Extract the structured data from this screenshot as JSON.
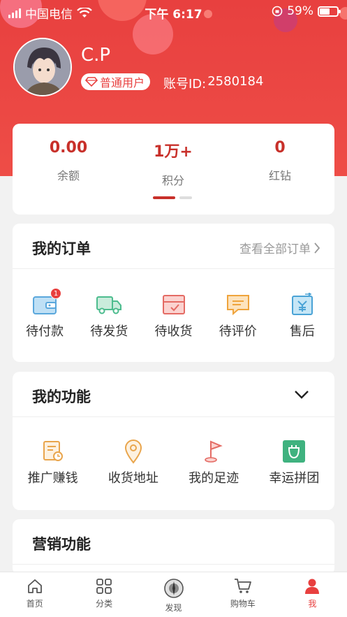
{
  "status_bar": {
    "carrier": "中国电信",
    "time": "下午 6:17",
    "battery_text": "59%",
    "battery_level": 0.59
  },
  "profile": {
    "name": "C.P",
    "level": "普通用户",
    "account_label": "账号ID:",
    "account_id": "2580184"
  },
  "stats": [
    {
      "value": "0.00",
      "label": "余额"
    },
    {
      "value": "1万+",
      "label": "积分"
    },
    {
      "value": "0",
      "label": "红钻"
    }
  ],
  "orders": {
    "title": "我的订单",
    "view_all": "查看全部订单",
    "items": [
      {
        "label": "待付款",
        "icon": "wallet-icon",
        "badge": "1"
      },
      {
        "label": "待发货",
        "icon": "truck-icon"
      },
      {
        "label": "待收货",
        "icon": "package-icon"
      },
      {
        "label": "待评价",
        "icon": "comment-icon"
      },
      {
        "label": "售后",
        "icon": "refund-icon"
      }
    ]
  },
  "functions": {
    "title": "我的功能",
    "items": [
      {
        "label": "推广赚钱",
        "icon": "promote-icon"
      },
      {
        "label": "收货地址",
        "icon": "location-icon"
      },
      {
        "label": "我的足迹",
        "icon": "flag-icon"
      },
      {
        "label": "幸运拼团",
        "icon": "lucky-group-icon"
      }
    ]
  },
  "marketing": {
    "title": "营销功能"
  },
  "tabbar": [
    {
      "label": "首页",
      "icon": "home-icon"
    },
    {
      "label": "分类",
      "icon": "category-icon"
    },
    {
      "label": "发现",
      "icon": "discover-icon"
    },
    {
      "label": "购物车",
      "icon": "cart-icon"
    },
    {
      "label": "我",
      "icon": "user-icon",
      "active": true
    }
  ],
  "colors": {
    "brand": "#e8403f",
    "accent_text": "#c8302a"
  }
}
